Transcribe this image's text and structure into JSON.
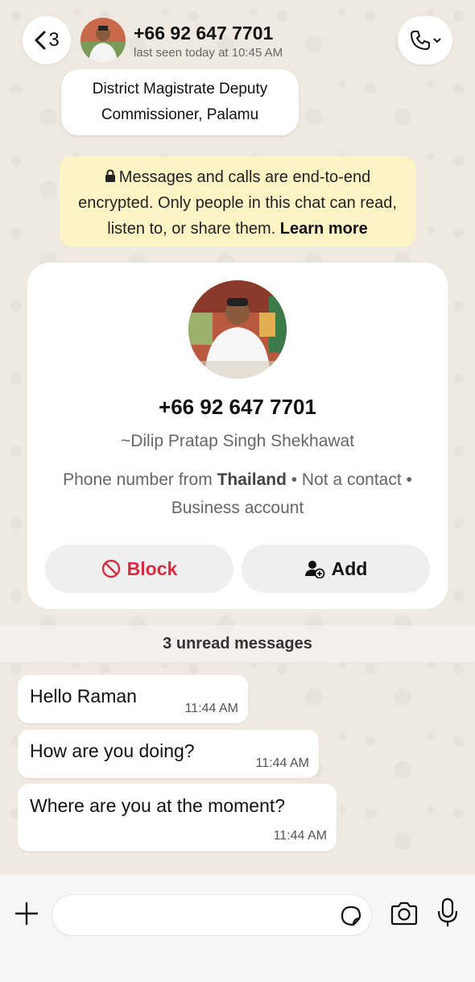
{
  "header": {
    "back_count": "3",
    "title": "+66 92 647 7701",
    "subtitle": "last seen today at 10:45 AM"
  },
  "tooltip": {
    "line1": "District Magistrate Deputy",
    "line2": "Commissioner, Palamu"
  },
  "encryption": {
    "text": "Messages and calls are end-to-end encrypted. Only people in this chat can read, listen to, or share them.",
    "link": "Learn more"
  },
  "profile": {
    "phone": "+66 92 647 7701",
    "name": "~Dilip Pratap Singh Shekhawat",
    "info_prefix": "Phone number from ",
    "country": "Thailand",
    "info_suffix": " • Not a contact • Business account",
    "block_label": "Block",
    "add_label": "Add"
  },
  "unread_label": "3 unread messages",
  "messages": [
    {
      "text": "Hello Raman",
      "time": "11:44 AM"
    },
    {
      "text": "How are you doing?",
      "time": "11:44 AM"
    },
    {
      "text": "Where are you at the moment?",
      "time": "11:44 AM"
    }
  ],
  "input": {
    "placeholder": ""
  },
  "colors": {
    "block_red": "#d42e43",
    "encrypt_bg": "#fdf4c5",
    "wallpaper": "#efe9e1"
  }
}
